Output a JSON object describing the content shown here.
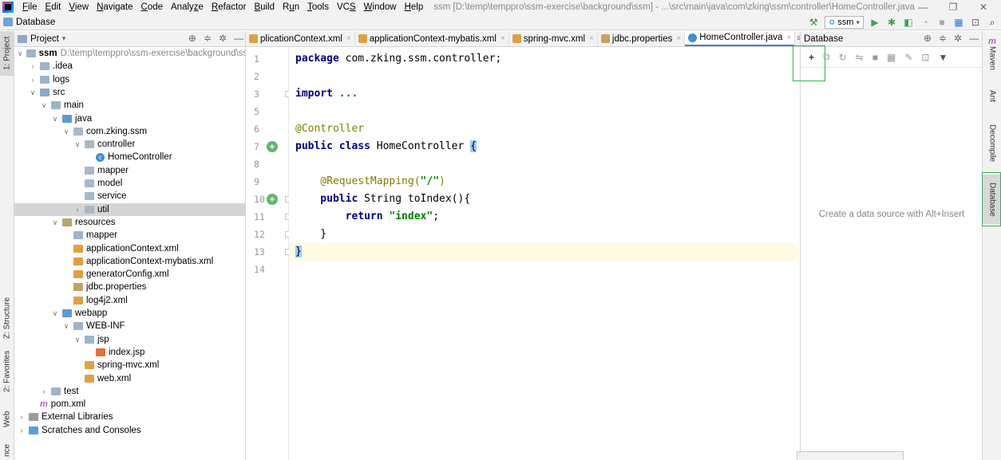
{
  "menubar": {
    "items": [
      "File",
      "Edit",
      "View",
      "Navigate",
      "Code",
      "Analyze",
      "Refactor",
      "Build",
      "Run",
      "Tools",
      "VCS",
      "Window",
      "Help"
    ],
    "window_title": "ssm [D:\\temp\\temppro\\ssm-exercise\\background\\ssm] - ...\\src\\main\\java\\com\\zking\\ssm\\controller\\HomeController.java",
    "minimize": "—",
    "maximize": "❐",
    "close": "✕"
  },
  "navbar": {
    "breadcrumb": "Database",
    "run_config": "ssm"
  },
  "left_strip": {
    "tabs": [
      "1: Project",
      "Z: Structure",
      "2: Favorites",
      "Web",
      "nce"
    ]
  },
  "project": {
    "header_label": "Project",
    "tree": [
      {
        "label": "ssm",
        "suffix": "D:\\temp\\temppro\\ssm-exercise\\background\\ssm",
        "icon": "folder",
        "indent": 0,
        "arrow": "down",
        "bold": true
      },
      {
        "label": ".idea",
        "icon": "folder",
        "indent": 1,
        "arrow": "right"
      },
      {
        "label": "logs",
        "icon": "folder",
        "indent": 1,
        "arrow": "right"
      },
      {
        "label": "src",
        "icon": "folder-src",
        "indent": 1,
        "arrow": "down"
      },
      {
        "label": "main",
        "icon": "folder",
        "indent": 2,
        "arrow": "down"
      },
      {
        "label": "java",
        "icon": "folder-java",
        "indent": 3,
        "arrow": "down"
      },
      {
        "label": "com.zking.ssm",
        "icon": "package",
        "indent": 4,
        "arrow": "down"
      },
      {
        "label": "controller",
        "icon": "package",
        "indent": 5,
        "arrow": "down"
      },
      {
        "label": "HomeController",
        "icon": "class",
        "indent": 6,
        "arrow": ""
      },
      {
        "label": "mapper",
        "icon": "package",
        "indent": 5,
        "arrow": ""
      },
      {
        "label": "model",
        "icon": "package",
        "indent": 5,
        "arrow": ""
      },
      {
        "label": "service",
        "icon": "package",
        "indent": 5,
        "arrow": ""
      },
      {
        "label": "util",
        "icon": "package",
        "indent": 5,
        "arrow": "right",
        "selected": true
      },
      {
        "label": "resources",
        "icon": "folder-res",
        "indent": 3,
        "arrow": "down"
      },
      {
        "label": "mapper",
        "icon": "folder",
        "indent": 4,
        "arrow": ""
      },
      {
        "label": "applicationContext.xml",
        "icon": "xml",
        "indent": 4,
        "arrow": ""
      },
      {
        "label": "applicationContext-mybatis.xml",
        "icon": "xml",
        "indent": 4,
        "arrow": ""
      },
      {
        "label": "generatorConfig.xml",
        "icon": "xml",
        "indent": 4,
        "arrow": ""
      },
      {
        "label": "jdbc.properties",
        "icon": "props",
        "indent": 4,
        "arrow": ""
      },
      {
        "label": "log4j2.xml",
        "icon": "xml",
        "indent": 4,
        "arrow": ""
      },
      {
        "label": "webapp",
        "icon": "folder-java",
        "indent": 3,
        "arrow": "down"
      },
      {
        "label": "WEB-INF",
        "icon": "folder",
        "indent": 4,
        "arrow": "down"
      },
      {
        "label": "jsp",
        "icon": "folder",
        "indent": 5,
        "arrow": "down"
      },
      {
        "label": "index.jsp",
        "icon": "jsp",
        "indent": 6,
        "arrow": ""
      },
      {
        "label": "spring-mvc.xml",
        "icon": "xml",
        "indent": 5,
        "arrow": ""
      },
      {
        "label": "web.xml",
        "icon": "xml",
        "indent": 5,
        "arrow": ""
      },
      {
        "label": "test",
        "icon": "folder",
        "indent": 2,
        "arrow": "right"
      },
      {
        "label": "pom.xml",
        "icon": "maven",
        "indent": 1,
        "arrow": ""
      },
      {
        "label": "External Libraries",
        "icon": "libs",
        "indent": 0,
        "arrow": "right"
      },
      {
        "label": "Scratches and Consoles",
        "icon": "scratch",
        "indent": 0,
        "arrow": "right"
      }
    ]
  },
  "editor": {
    "tabs": [
      {
        "label": "plicationContext.xml",
        "icon": "xml",
        "active": false
      },
      {
        "label": "applicationContext-mybatis.xml",
        "icon": "xml",
        "active": false
      },
      {
        "label": "spring-mvc.xml",
        "icon": "xml",
        "active": false
      },
      {
        "label": "jdbc.properties",
        "icon": "props",
        "active": false
      },
      {
        "label": "HomeController.java",
        "icon": "class",
        "active": true
      }
    ],
    "more_tabs": "≡4",
    "lines": [
      {
        "num": "1",
        "tokens": [
          {
            "t": "package ",
            "c": "kw"
          },
          {
            "t": "com.zking.ssm.controller;",
            "c": ""
          }
        ]
      },
      {
        "num": "2",
        "tokens": []
      },
      {
        "num": "3",
        "tokens": [
          {
            "t": "import ",
            "c": "kw"
          },
          {
            "t": "...",
            "c": "str"
          }
        ]
      },
      {
        "num": "5",
        "tokens": []
      },
      {
        "num": "6",
        "tokens": [
          {
            "t": "@Controller",
            "c": "ann"
          }
        ]
      },
      {
        "num": "7",
        "tokens": [
          {
            "t": "public class ",
            "c": "kw"
          },
          {
            "t": "HomeController ",
            "c": ""
          },
          {
            "t": "{",
            "c": "brace"
          }
        ],
        "gutter_icon": true
      },
      {
        "num": "8",
        "tokens": []
      },
      {
        "num": "9",
        "tokens": [
          {
            "t": "    @RequestMapping(",
            "c": "ann"
          },
          {
            "t": "\"/\"",
            "c": "str"
          },
          {
            "t": ")",
            "c": "ann"
          }
        ]
      },
      {
        "num": "10",
        "tokens": [
          {
            "t": "    public ",
            "c": "kw"
          },
          {
            "t": "String toIndex(){",
            "c": ""
          }
        ],
        "gutter_icon": true
      },
      {
        "num": "11",
        "tokens": [
          {
            "t": "        return ",
            "c": "kw"
          },
          {
            "t": "\"index\"",
            "c": "str"
          },
          {
            "t": ";",
            "c": ""
          }
        ]
      },
      {
        "num": "12",
        "tokens": [
          {
            "t": "    }",
            "c": ""
          }
        ]
      },
      {
        "num": "13",
        "tokens": [
          {
            "t": "}",
            "c": "brace"
          }
        ],
        "current": true
      },
      {
        "num": "14",
        "tokens": []
      }
    ]
  },
  "database": {
    "header_label": "Database",
    "empty_text": "Create a data source with Alt+Insert"
  },
  "right_strip": {
    "tabs": [
      "Maven",
      "Ant",
      "Decompile",
      "Database"
    ]
  }
}
